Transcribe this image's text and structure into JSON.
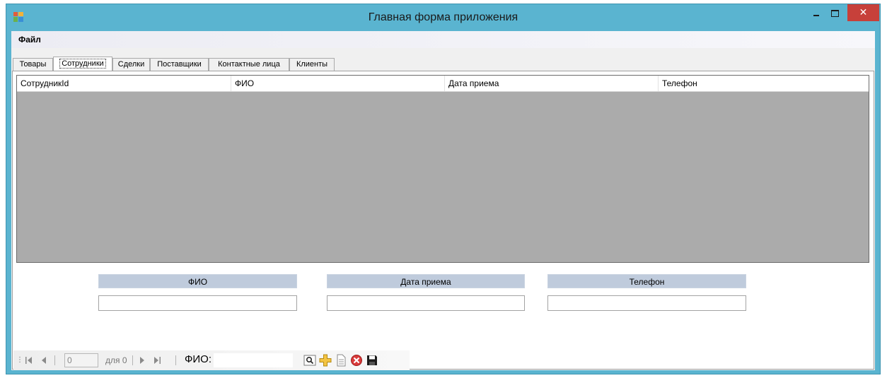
{
  "window": {
    "title": "Главная форма приложения"
  },
  "menu": {
    "file": "Файл"
  },
  "tabs": [
    {
      "label": "Товары"
    },
    {
      "label": "Сотрудники"
    },
    {
      "label": "Сделки"
    },
    {
      "label": "Поставщики"
    },
    {
      "label": "Контактные лица"
    },
    {
      "label": "Клиенты"
    }
  ],
  "grid": {
    "columns": [
      "СотрудникId",
      "ФИО",
      "Дата приема",
      "Телефон"
    ],
    "background": "#ababab"
  },
  "form": {
    "fio_label": "ФИО",
    "date_label": "Дата приема",
    "phone_label": "Телефон",
    "fio_value": "",
    "date_value": "",
    "phone_value": ""
  },
  "navigator": {
    "position": "0",
    "count": "для 0",
    "search_label": "ФИО:",
    "search_value": ""
  },
  "icons": [
    "move-first-icon",
    "move-previous-icon",
    "move-next-icon",
    "move-last-icon",
    "search-icon",
    "add-icon",
    "document-icon",
    "delete-icon",
    "save-icon"
  ],
  "colors": {
    "titlebar": "#5ab4d0",
    "close_button": "#c7403a",
    "label_box": "#bfcbdc",
    "grid_background": "#ababab"
  }
}
